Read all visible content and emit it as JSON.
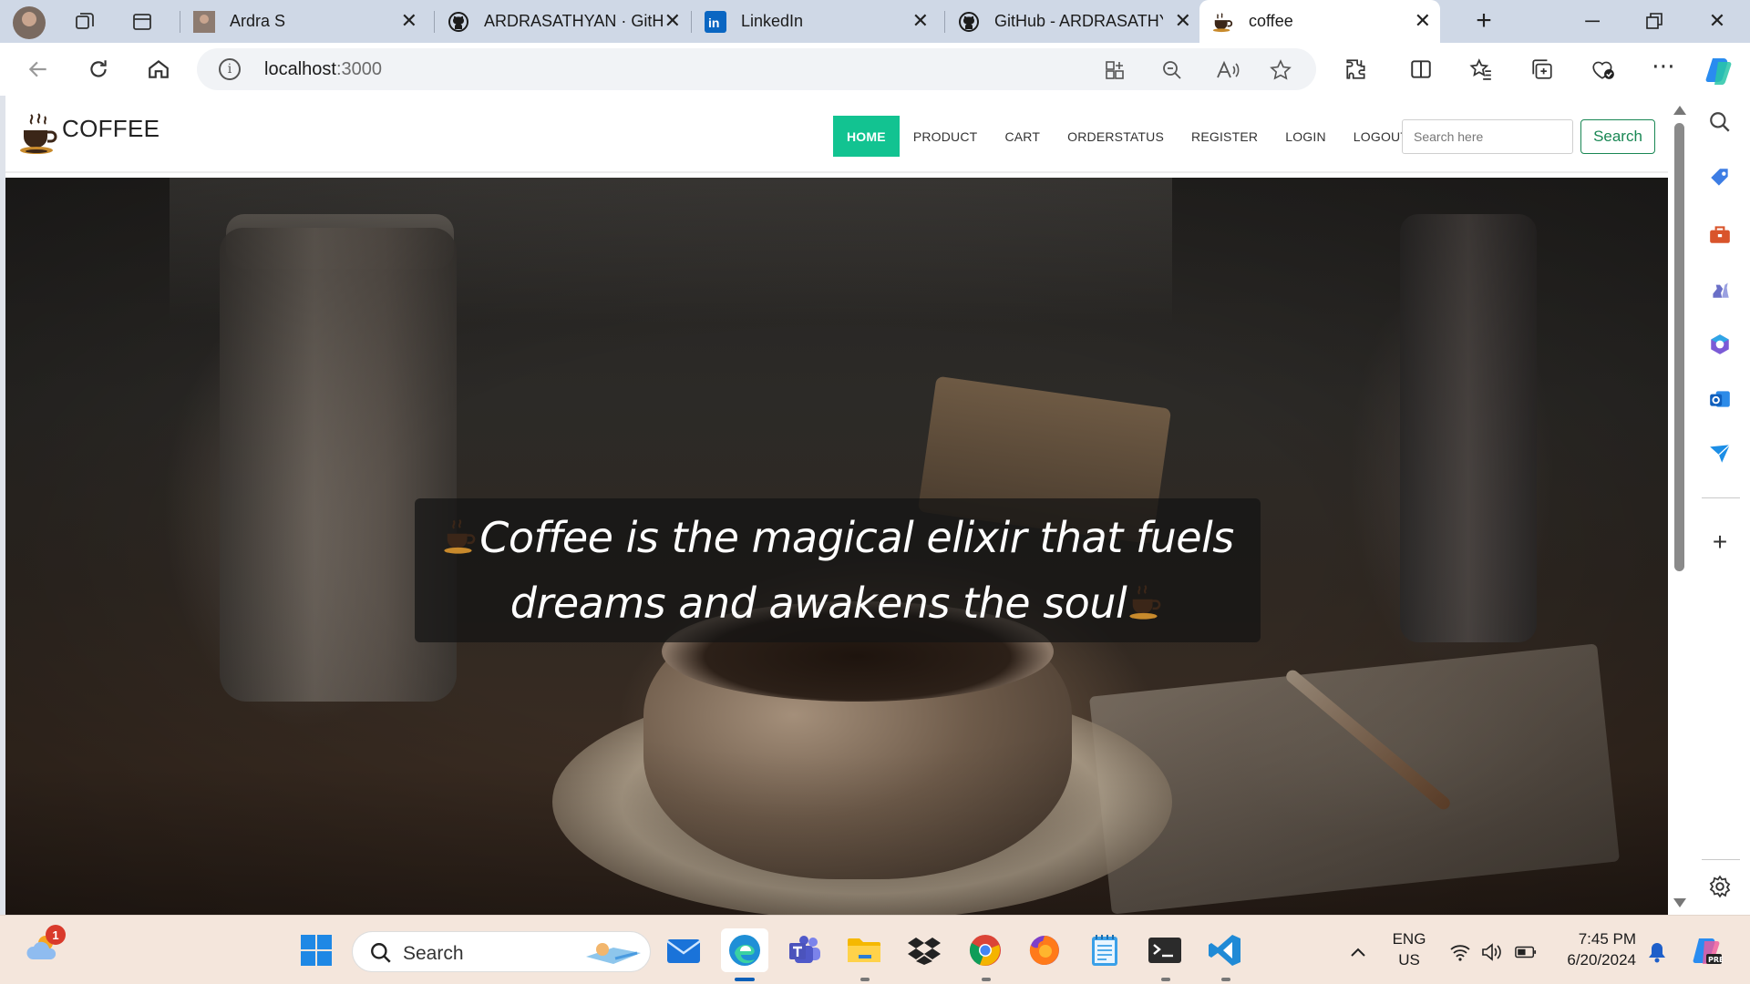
{
  "browser": {
    "tabs": [
      {
        "title": "Ardra S",
        "favicon": "profile-photo",
        "active": false
      },
      {
        "title": "ARDRASATHYAN · GitH",
        "favicon": "github-icon",
        "active": false
      },
      {
        "title": "LinkedIn",
        "favicon": "linkedin-icon",
        "active": false
      },
      {
        "title": "GitHub - ARDRASATHY",
        "favicon": "github-icon",
        "active": false
      },
      {
        "title": "coffee",
        "favicon": "coffee-cup-icon",
        "active": true
      }
    ],
    "new_tab": "+",
    "address": {
      "host": "localhost",
      "port": ":3000"
    }
  },
  "site": {
    "brand": "COFFEE",
    "nav": [
      {
        "label": "HOME",
        "active": true
      },
      {
        "label": "PRODUCT"
      },
      {
        "label": "CART"
      },
      {
        "label": "ORDERSTATUS"
      },
      {
        "label": "REGISTER"
      },
      {
        "label": "LOGIN"
      },
      {
        "label": "LOGOUT"
      }
    ],
    "search_placeholder": "Search here",
    "search_button": "Search",
    "accent": "#12c391",
    "search_button_color": "#198754",
    "hero": {
      "line1": "Coffee is the magical elixir that fuels",
      "line2": "dreams and awakens the soul"
    }
  },
  "taskbar": {
    "weather_badge": "1",
    "search_label": "Search",
    "lang": "ENG",
    "region": "US",
    "time": "7:45 PM",
    "date": "6/20/2024"
  }
}
